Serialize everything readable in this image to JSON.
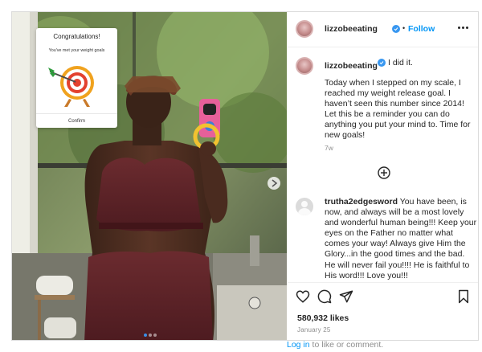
{
  "post": {
    "username": "lizzobeeating",
    "verified_icon": "verified-badge-icon",
    "separator": "•",
    "follow_label": "Follow",
    "more_icon": "more-options-icon"
  },
  "popup": {
    "title": "Congratulations!",
    "subtitle": "You've met your weight goals",
    "confirm_label": "Confirm",
    "icon": "target-arrow-icon"
  },
  "caption": {
    "username": "lizzobeeating",
    "lead": "I did it.",
    "body": "Today when I stepped on my scale, I reached my weight release goal. I haven’t seen this number since 2014! Let this be a reminder you can do anything you put your mind to. Time for new goals!",
    "time": "7w"
  },
  "comment": {
    "username": "trutha2edgesword",
    "text": " You have been, is now, and always will be a most lovely and wonderful human being!!! Keep your eyes on the Father no matter what comes your way! Always give Him the Glory...in the good times and the bad. He will never fail you!!!! He is faithful to His word!!! Love you!!!"
  },
  "actions": {
    "icons": [
      "heart-icon",
      "comment-icon",
      "share-icon",
      "bookmark-icon"
    ],
    "likes": "580,932 likes",
    "date": "January 25"
  },
  "footer": {
    "login_link": "Log in",
    "login_rest": " to like or comment."
  },
  "carousel": {
    "dot_count": 3,
    "active_index": 0
  },
  "colors": {
    "link_blue": "#0095f6",
    "verified_blue": "#3897f0",
    "muted_gray": "#8e8e8e",
    "text": "#262626"
  }
}
